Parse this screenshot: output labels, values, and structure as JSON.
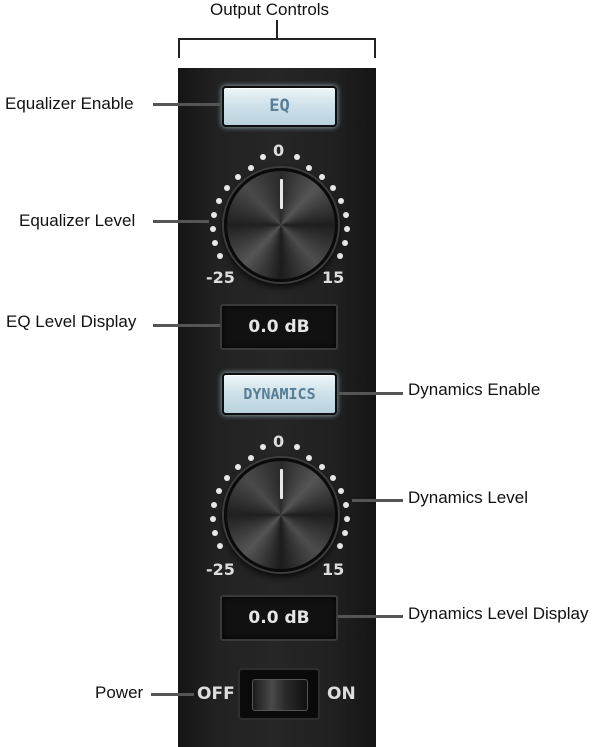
{
  "title": "Output Controls",
  "callouts": {
    "eq_enable": "Equalizer Enable",
    "eq_level": "Equalizer Level",
    "eq_display": "EQ Level Display",
    "dyn_enable": "Dynamics Enable",
    "dyn_level": "Dynamics Level",
    "dyn_display": "Dynamics Level Display",
    "power": "Power"
  },
  "eq": {
    "button_label": "EQ",
    "scale_top": "0",
    "scale_min": "-25",
    "scale_max": "15",
    "display_value": "0.0 dB"
  },
  "dynamics": {
    "button_label": "DYNAMICS",
    "scale_top": "0",
    "scale_min": "-25",
    "scale_max": "15",
    "display_value": "0.0 dB"
  },
  "power": {
    "off_label": "OFF",
    "on_label": "ON"
  }
}
